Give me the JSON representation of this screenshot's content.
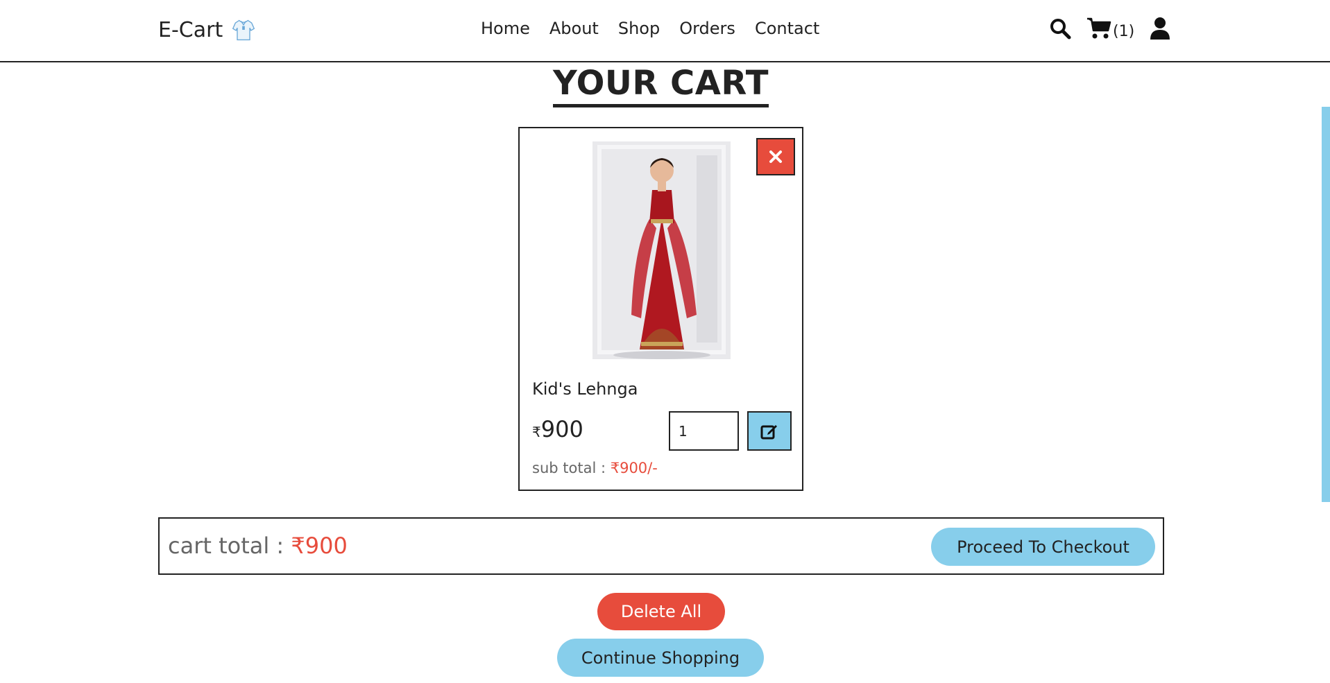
{
  "header": {
    "logo_text": "E-Cart",
    "logo_icon": "shirt-icon",
    "nav": [
      "Home",
      "About",
      "Shop",
      "Orders",
      "Contact"
    ],
    "cart_count": "(1)",
    "icons": [
      "search-icon",
      "cart-icon",
      "user-icon"
    ]
  },
  "page": {
    "title": "YOUR CART"
  },
  "cart_items": [
    {
      "name": "Kid's Lehnga",
      "currency_symbol": "₹",
      "price": "900",
      "quantity": "1",
      "subtotal_label": "sub total :",
      "subtotal_value": "₹900/-"
    }
  ],
  "summary": {
    "total_label": "cart total :",
    "total_value": "₹900",
    "checkout_label": "Proceed To Checkout",
    "delete_all_label": "Delete All",
    "continue_label": "Continue Shopping"
  },
  "colors": {
    "accent_blue": "#87ceeb",
    "danger_red": "#e74c3c",
    "text_dark": "#222222",
    "text_muted": "#666666"
  }
}
